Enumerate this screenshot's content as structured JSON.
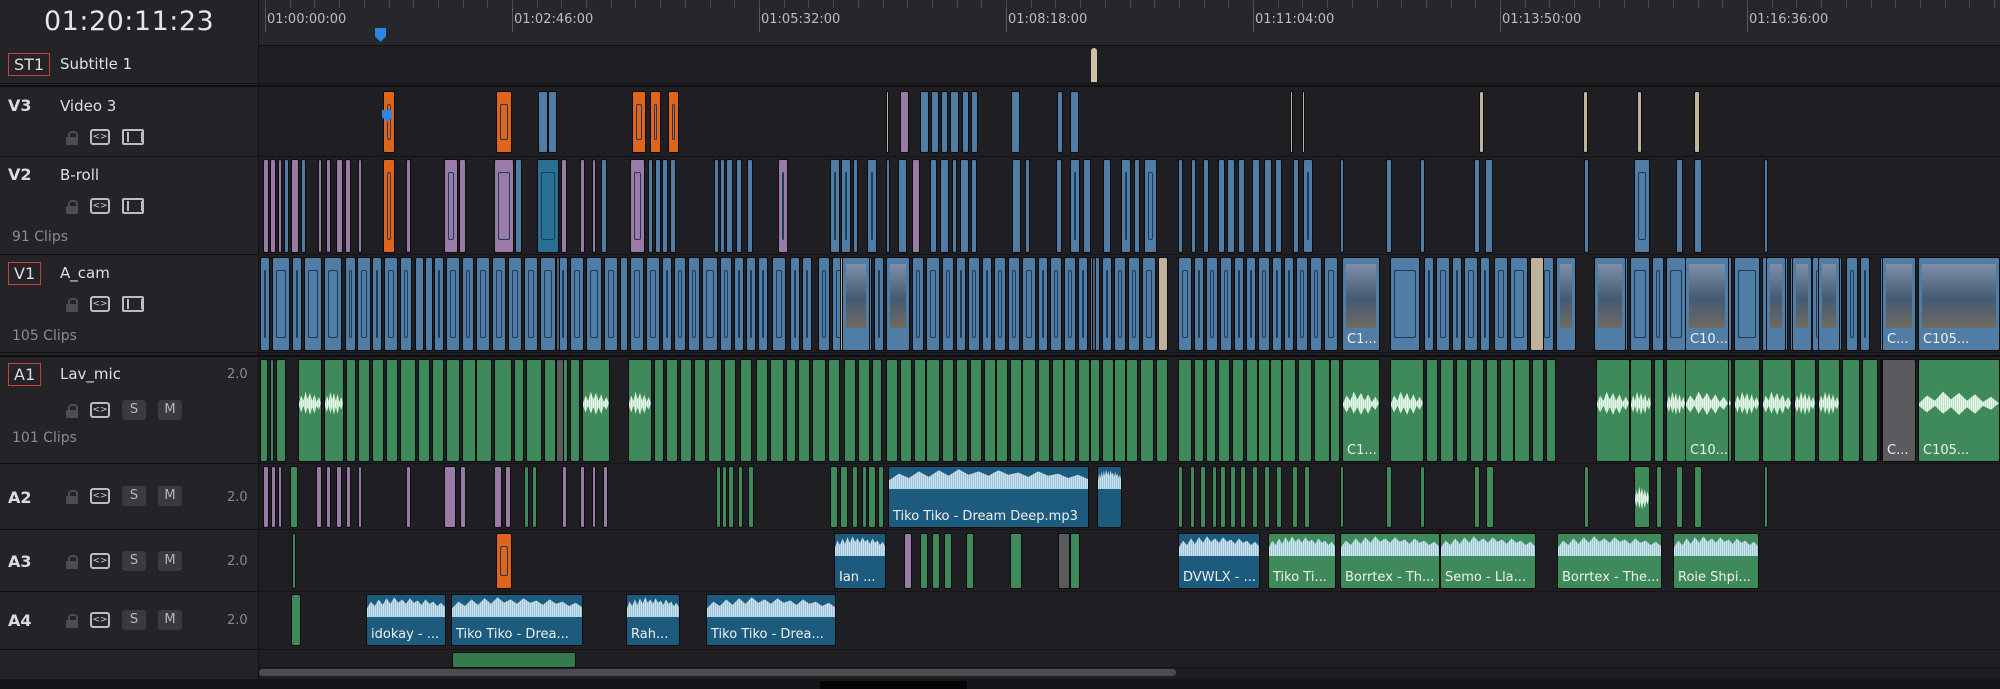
{
  "timecode": "01:20:11:23",
  "ruler": {
    "ticks": [
      "01:00:00:00",
      "01:02:46:00",
      "01:05:32:00",
      "01:08:18:00",
      "01:11:04:00",
      "01:13:50:00",
      "01:16:36:00"
    ]
  },
  "tracks": {
    "st1": {
      "id": "ST1",
      "name": "Subtitle 1"
    },
    "v3": {
      "id": "V3",
      "name": "Video 3"
    },
    "v2": {
      "id": "V2",
      "name": "B-roll",
      "clips": "91 Clips"
    },
    "v1": {
      "id": "V1",
      "name": "A_cam",
      "clips": "105 Clips"
    },
    "a1": {
      "id": "A1",
      "name": "Lav_mic",
      "volume": "2.0",
      "clips": "101 Clips"
    },
    "a2": {
      "id": "A2",
      "volume": "2.0"
    },
    "a3": {
      "id": "A3",
      "volume": "2.0"
    },
    "a4": {
      "id": "A4",
      "volume": "2.0"
    }
  },
  "buttons": {
    "solo": "S",
    "mute": "M",
    "auto_select": "<>"
  },
  "clip_labels": {
    "v1": [
      "C1...",
      "C10...",
      "C...",
      "C105..."
    ],
    "a1": [
      "C1...",
      "C10...",
      "C...",
      "C105..."
    ],
    "a2": [
      "Tiko Tiko - Dream Deep.mp3"
    ],
    "a3": [
      "Ian ...",
      "DVWLX - ...",
      "Tiko Ti...",
      "Borrtex - Th...",
      "Semo - Lla...",
      "Borrtex - The...",
      "Roie Shpi..."
    ],
    "a4": [
      "idokay - ...",
      "Tiko Tiko - Drea...",
      "Rah...",
      "Tiko Tiko - Drea..."
    ]
  },
  "colors": {
    "video": "#4f7da6",
    "broll": "#9a7aa6",
    "orange": "#e0641a",
    "audio": "#3f8a5a",
    "music": "#1c5b7e",
    "playhead": "#2b86e6",
    "record": "#c8423c"
  }
}
